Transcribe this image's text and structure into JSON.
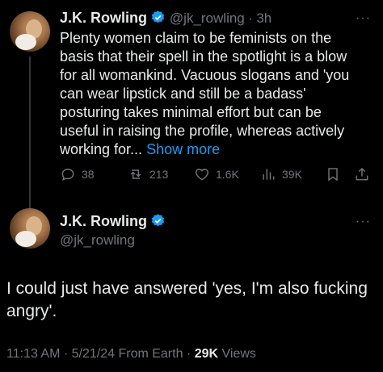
{
  "quoted_tweet": {
    "author_name": "J.K. Rowling",
    "handle": "@jk_rowling",
    "separator": "·",
    "time": "3h",
    "more_label": "···",
    "text_lines": [
      "Plenty women claim to be feminists on the",
      "basis that their spell in the spotlight is a blow",
      "for all womankind. Vacuous slogans and 'you",
      "can wear lipstick and still be a badass'",
      "posturing takes minimal effort but can be",
      "useful in raising the profile, whereas actively",
      "working for..."
    ],
    "show_more": "Show more",
    "actions": {
      "replies": "38",
      "reposts": "213",
      "likes": "1.6K",
      "views": "39K"
    }
  },
  "main_tweet": {
    "author_name": "J.K. Rowling",
    "handle": "@jk_rowling",
    "more_label": "···",
    "text_lines": [
      "I could just have answered 'yes, I'm also fucking",
      "angry'."
    ],
    "timestamp": "11:13 AM · 5/21/24 From Earth ·",
    "views_count": "29K",
    "views_label": "Views"
  },
  "colors": {
    "background": "#000000",
    "text": "#e7e9ea",
    "muted": "#71767b",
    "accent": "#1d9bf0"
  }
}
